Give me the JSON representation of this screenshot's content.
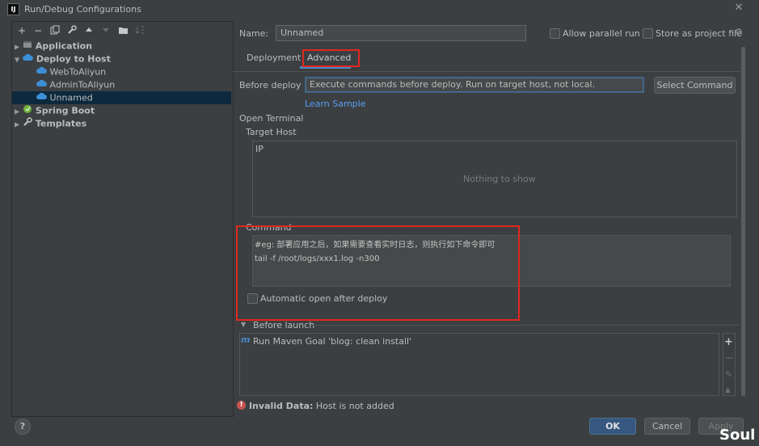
{
  "window": {
    "title": "Run/Debug Configurations",
    "app_icon_text": "IJ"
  },
  "toolbar": [
    "add-icon",
    "remove-icon",
    "copy-icon",
    "wrench-icon",
    "move-up-icon",
    "move-down-icon",
    "folder-icon",
    "sort-icon"
  ],
  "tree": {
    "application": "Application",
    "deploy_to_host": "Deploy to Host",
    "items": [
      "WebToAliyun",
      "AdminToAliyun",
      "Unnamed"
    ],
    "spring_boot": "Spring Boot",
    "templates": "Templates"
  },
  "name_label": "Name:",
  "name_value": "Unnamed",
  "allow_parallel": "Allow parallel run",
  "store_as_project": "Store as project file",
  "tabs": [
    "Deployment",
    "Advanced"
  ],
  "before_deploy": {
    "label": "Before deploy",
    "value": "Execute commands before deploy. Run on target host, not local.",
    "button": "Select Command",
    "learn": "Learn Sample"
  },
  "open_terminal": "Open Terminal",
  "target_host": "Target Host",
  "ip_header": "IP",
  "nothing": "Nothing to show",
  "command": {
    "label": "Command",
    "line1": "#eg: 部署应用之后，如果需要查看实时日志，则执行如下命令即可",
    "line2": "tail -f /root/logs/xxx1.log -n300"
  },
  "auto_open": "Automatic open after deploy",
  "before_launch": {
    "label": "Before launch",
    "task": "Run Maven Goal 'blog: clean install'"
  },
  "status": {
    "bold": "Invalid Data:",
    "text": "Host is not added"
  },
  "buttons": {
    "ok": "OK",
    "cancel": "Cancel",
    "apply": "Apply"
  },
  "help": "?",
  "watermark": "Soul"
}
